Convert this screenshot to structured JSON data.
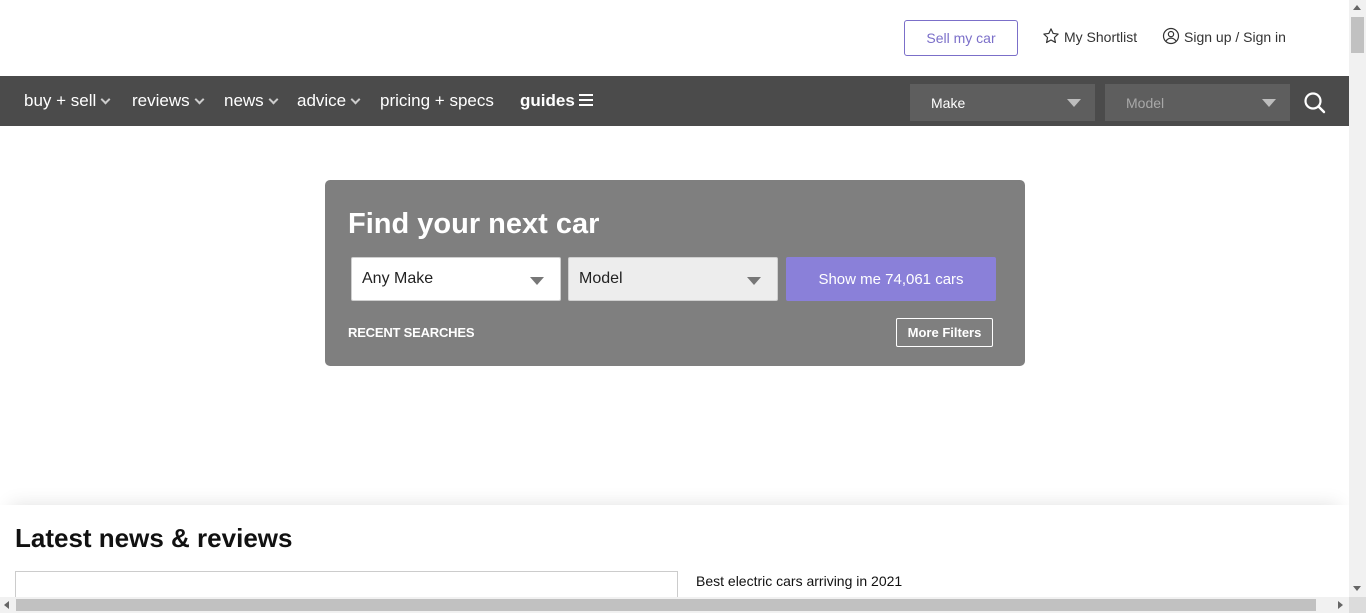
{
  "header": {
    "sell_label": "Sell my car",
    "shortlist_label": "My Shortlist",
    "signin_label": "Sign up / Sign in"
  },
  "nav": {
    "items": [
      {
        "label": "buy + sell",
        "has_dropdown": true
      },
      {
        "label": "reviews",
        "has_dropdown": true
      },
      {
        "label": "news",
        "has_dropdown": true
      },
      {
        "label": "advice",
        "has_dropdown": true
      },
      {
        "label": "pricing + specs",
        "has_dropdown": false
      },
      {
        "label": "guides",
        "icon": "hamburger-icon"
      }
    ],
    "make_select": "Make",
    "model_select": "Model",
    "search_icon": "search-icon"
  },
  "finder": {
    "title": "Find your next car",
    "make_value": "Any Make",
    "model_value": "Model",
    "show_button": "Show me 74,061 cars",
    "recent_label": "RECENT SEARCHES",
    "more_filters": "More Filters"
  },
  "latest": {
    "title": "Latest news & reviews",
    "first_article": "Best electric cars arriving in 2021"
  },
  "colors": {
    "accent": "#8a80d9",
    "nav_bg": "#4b4b4b",
    "finder_bg": "#7f7f7f"
  }
}
